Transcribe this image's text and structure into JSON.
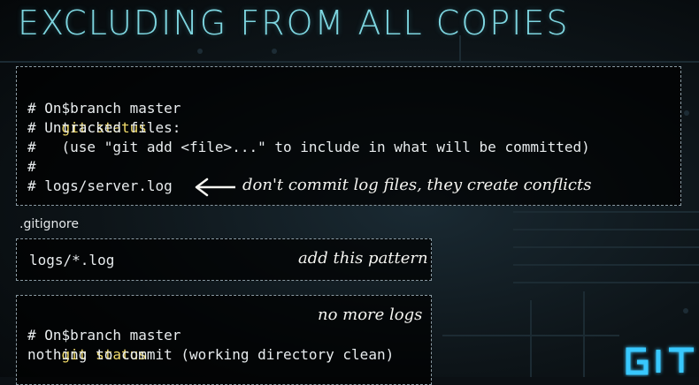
{
  "title": "EXCLUDING FROM ALL COPIES",
  "terminal1": {
    "prompt": "$",
    "command": "git status",
    "lines": [
      "# On branch master",
      "# Untracked files:",
      "#   (use \"git add <file>...\" to include in what will be committed)",
      "#",
      "# logs/server.log"
    ],
    "annotation": "don't commit log files, they create conflicts"
  },
  "gitignore": {
    "label": ".gitignore",
    "pattern": "logs/*.log",
    "annotation": "add this pattern"
  },
  "terminal2": {
    "prompt": "$",
    "command": "git status",
    "annotation": "no more logs",
    "lines": [
      "# On branch master",
      "nothing to commit (working directory clean)"
    ]
  },
  "logo_text": "GIT",
  "colors": {
    "title": "#7ed6e0",
    "command": "#f2dc6a",
    "text": "#e8ecee",
    "logo": "#38c8ff"
  }
}
